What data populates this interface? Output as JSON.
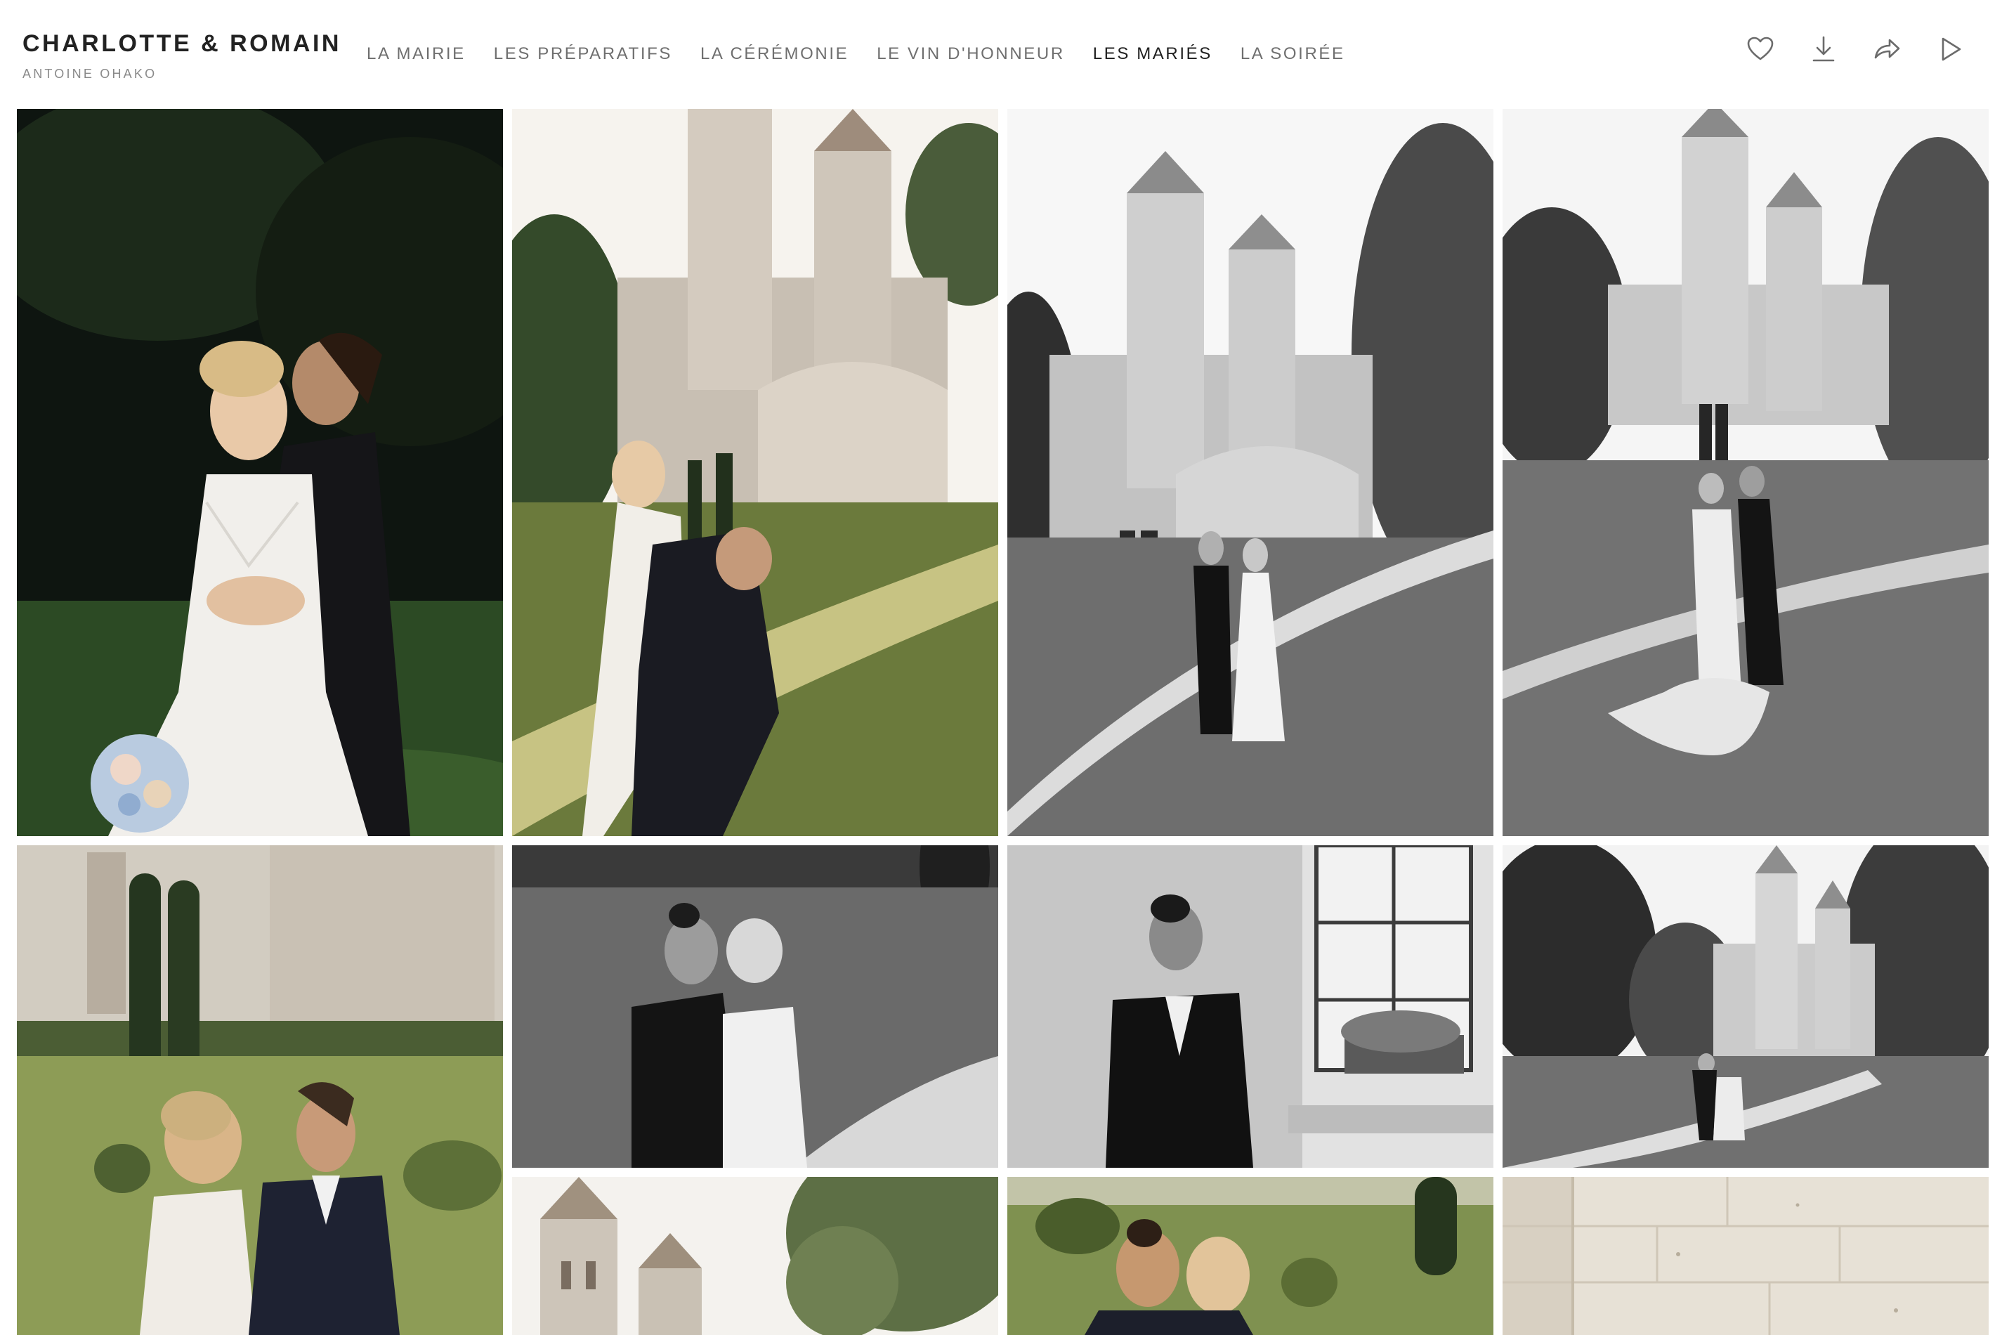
{
  "gallery": {
    "title": "CHARLOTTE & ROMAIN",
    "photographer": "ANTOINE OHAKO"
  },
  "nav": {
    "items": [
      {
        "label": "LA MAIRIE"
      },
      {
        "label": "LES PRÉPARATIFS"
      },
      {
        "label": "LA CÉRÉMONIE"
      },
      {
        "label": "LE VIN D'HONNEUR"
      },
      {
        "label": "LES MARIÉS",
        "active": true
      },
      {
        "label": "LA SOIRÉE"
      }
    ]
  },
  "actions": {
    "icons": [
      "heart-icon",
      "download-icon",
      "share-icon",
      "play-icon"
    ]
  },
  "photos": [
    {
      "name": "couple-portrait-garden-color",
      "tone": "color-dark"
    },
    {
      "name": "groom-lifting-bride-church-color",
      "tone": "color-light"
    },
    {
      "name": "couple-walking-church-bw",
      "tone": "bw"
    },
    {
      "name": "couple-kissing-church-bw",
      "tone": "bw"
    },
    {
      "name": "couple-embrace-garden-color",
      "tone": "color-light"
    },
    {
      "name": "couple-forehead-bw",
      "tone": "bw"
    },
    {
      "name": "groom-leaning-wall-bw",
      "tone": "bw"
    },
    {
      "name": "couple-dip-kiss-church-bw",
      "tone": "bw"
    },
    {
      "name": "church-towers-color",
      "tone": "color-light"
    },
    {
      "name": "couple-hug-garden-color",
      "tone": "color-light"
    },
    {
      "name": "stone-wall-color",
      "tone": "color-light"
    }
  ],
  "colors": {
    "title": "#222222",
    "nav_text": "#6f6f6f",
    "nav_active": "#1f1f1f",
    "icon_stroke": "#6b6b6b"
  }
}
